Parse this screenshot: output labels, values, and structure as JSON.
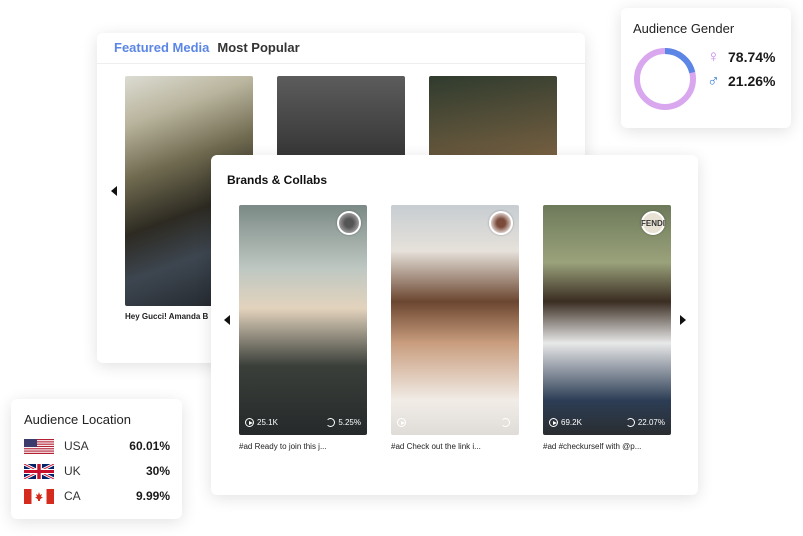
{
  "featured": {
    "tabs": [
      "Featured Media",
      "Most Popular"
    ],
    "caption": "Hey Gucci! Amanda B"
  },
  "gender": {
    "title": "Audience Gender",
    "female": "78.74%",
    "male": "21.26%",
    "female_fraction": 0.7874,
    "colors": {
      "female": "#d9a7ee",
      "male": "#5b86e5"
    }
  },
  "brands": {
    "title": "Brands & Collabs",
    "items": [
      {
        "views": "25.1K",
        "engagement": "5.25%",
        "caption": "#ad Ready to join this j..."
      },
      {
        "views": "",
        "engagement": "",
        "caption": "#ad Check out the link i..."
      },
      {
        "views": "69.2K",
        "engagement": "22.07%",
        "caption": "#ad #checkurself with @p...",
        "avatar_text": "FENDI"
      }
    ]
  },
  "location": {
    "title": "Audience Location",
    "rows": [
      {
        "country": "USA",
        "value": "60.01%"
      },
      {
        "country": "UK",
        "value": "30%"
      },
      {
        "country": "CA",
        "value": "9.99%"
      }
    ]
  }
}
